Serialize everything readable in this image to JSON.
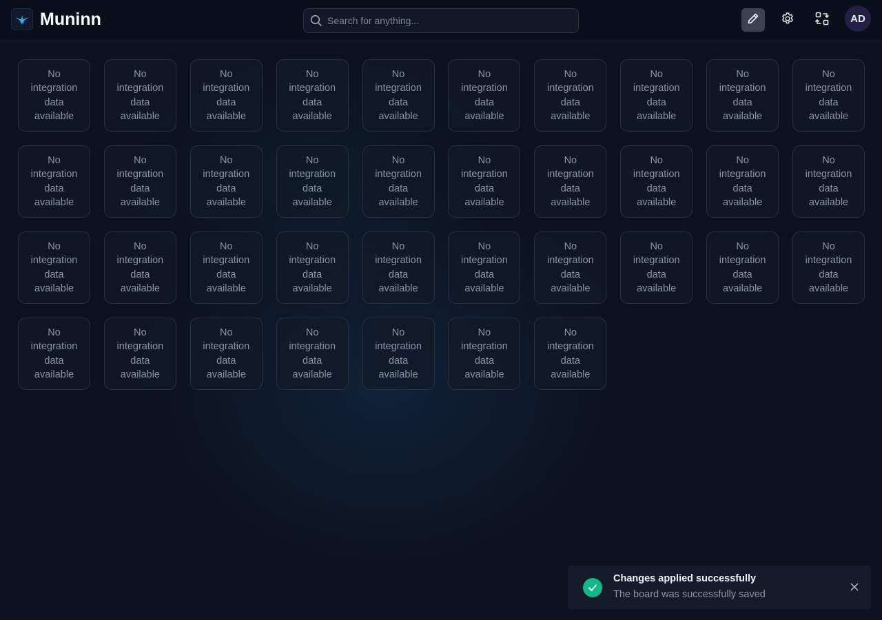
{
  "header": {
    "app_name": "Muninn",
    "logo_icon": "raven-logo-icon",
    "search_placeholder": "Search for anything...",
    "actions": [
      {
        "name": "edit-mode-button",
        "icon": "pencil-icon",
        "active": true
      },
      {
        "name": "settings-button",
        "icon": "gear-icon",
        "active": false
      },
      {
        "name": "switch-board-button",
        "icon": "swap-arrows-icon",
        "active": false
      }
    ],
    "user_initials": "AD"
  },
  "board": {
    "tile_message": "No integration data available",
    "tile_count": 37
  },
  "toast": {
    "title": "Changes applied successfully",
    "message": "The board was successfully saved",
    "status_color": "#12b886"
  },
  "colors": {
    "accent": "#3b4250",
    "success": "#12b886",
    "background": "#0b111d"
  }
}
